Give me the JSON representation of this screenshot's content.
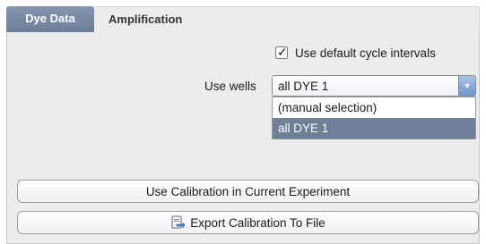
{
  "tabs": [
    {
      "label": "Dye Data",
      "active": true
    },
    {
      "label": "Amplification",
      "active": false
    }
  ],
  "options": {
    "default_cycle_checkbox": {
      "label": "Use default cycle intervals",
      "checked": true
    },
    "wells": {
      "label": "Use wells",
      "selected_value": "all DYE 1",
      "dropdown_open": true,
      "items": [
        "(manual selection)",
        "all DYE 1"
      ],
      "highlighted_index": 1
    }
  },
  "buttons": {
    "use_calibration": "Use Calibration in Current Experiment",
    "export_calibration": "Export Calibration To File"
  },
  "icons": {
    "checkmark": "check-icon",
    "dropdown_arrow": "chevron-down-icon",
    "export": "export-file-icon"
  },
  "colors": {
    "active_tab": "#7a8aa4",
    "selected_option": "#6e7f98",
    "dropdown_arrow": "#6f97cc"
  }
}
